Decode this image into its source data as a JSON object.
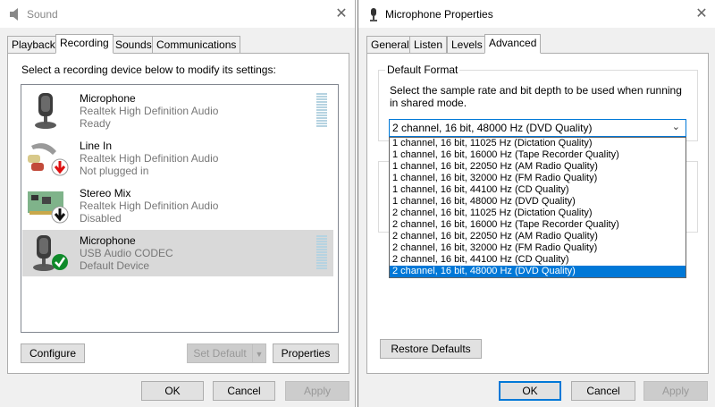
{
  "sound": {
    "title": "Sound",
    "close": "✕",
    "tabs": [
      {
        "label": "Playback"
      },
      {
        "label": "Recording"
      },
      {
        "label": "Sounds"
      },
      {
        "label": "Communications"
      }
    ],
    "prompt": "Select a recording device below to modify its settings:",
    "devices": [
      {
        "name": "Microphone",
        "driver": "Realtek High Definition Audio",
        "status": "Ready",
        "icon": "microphone-icon"
      },
      {
        "name": "Line In",
        "driver": "Realtek High Definition Audio",
        "status": "Not plugged in",
        "icon": "line-in-icon",
        "badge": "down-arrow-red"
      },
      {
        "name": "Stereo Mix",
        "driver": "Realtek High Definition Audio",
        "status": "Disabled",
        "icon": "circuit-board-icon",
        "badge": "down-arrow-black"
      },
      {
        "name": "Microphone",
        "driver": "USB Audio CODEC",
        "status": "Default Device",
        "icon": "microphone-icon",
        "badge": "check-green"
      }
    ],
    "buttons": {
      "configure": "Configure",
      "set_default": "Set Default",
      "properties": "Properties",
      "ok": "OK",
      "cancel": "Cancel",
      "apply": "Apply"
    }
  },
  "mic": {
    "title": "Microphone Properties",
    "close": "✕",
    "tabs": [
      {
        "label": "General"
      },
      {
        "label": "Listen"
      },
      {
        "label": "Levels"
      },
      {
        "label": "Advanced"
      }
    ],
    "group_title": "Default Format",
    "description": "Select the sample rate and bit depth to be used when running in shared mode.",
    "selected_format": "2 channel, 16 bit, 48000 Hz (DVD Quality)",
    "options": [
      "1 channel, 16 bit, 11025 Hz (Dictation Quality)",
      "1 channel, 16 bit, 16000 Hz (Tape Recorder Quality)",
      "1 channel, 16 bit, 22050 Hz (AM Radio Quality)",
      "1 channel, 16 bit, 32000 Hz (FM Radio Quality)",
      "1 channel, 16 bit, 44100 Hz (CD Quality)",
      "1 channel, 16 bit, 48000 Hz (DVD Quality)",
      "2 channel, 16 bit, 11025 Hz (Dictation Quality)",
      "2 channel, 16 bit, 16000 Hz (Tape Recorder Quality)",
      "2 channel, 16 bit, 22050 Hz (AM Radio Quality)",
      "2 channel, 16 bit, 32000 Hz (FM Radio Quality)",
      "2 channel, 16 bit, 44100 Hz (CD Quality)",
      "2 channel, 16 bit, 48000 Hz (DVD Quality)"
    ],
    "buttons": {
      "restore_defaults": "Restore Defaults",
      "ok": "OK",
      "cancel": "Cancel",
      "apply": "Apply"
    }
  },
  "colors": {
    "accent": "#0078d7",
    "selected_row": "#d9d9d9",
    "meter": "#b6d3e1"
  }
}
